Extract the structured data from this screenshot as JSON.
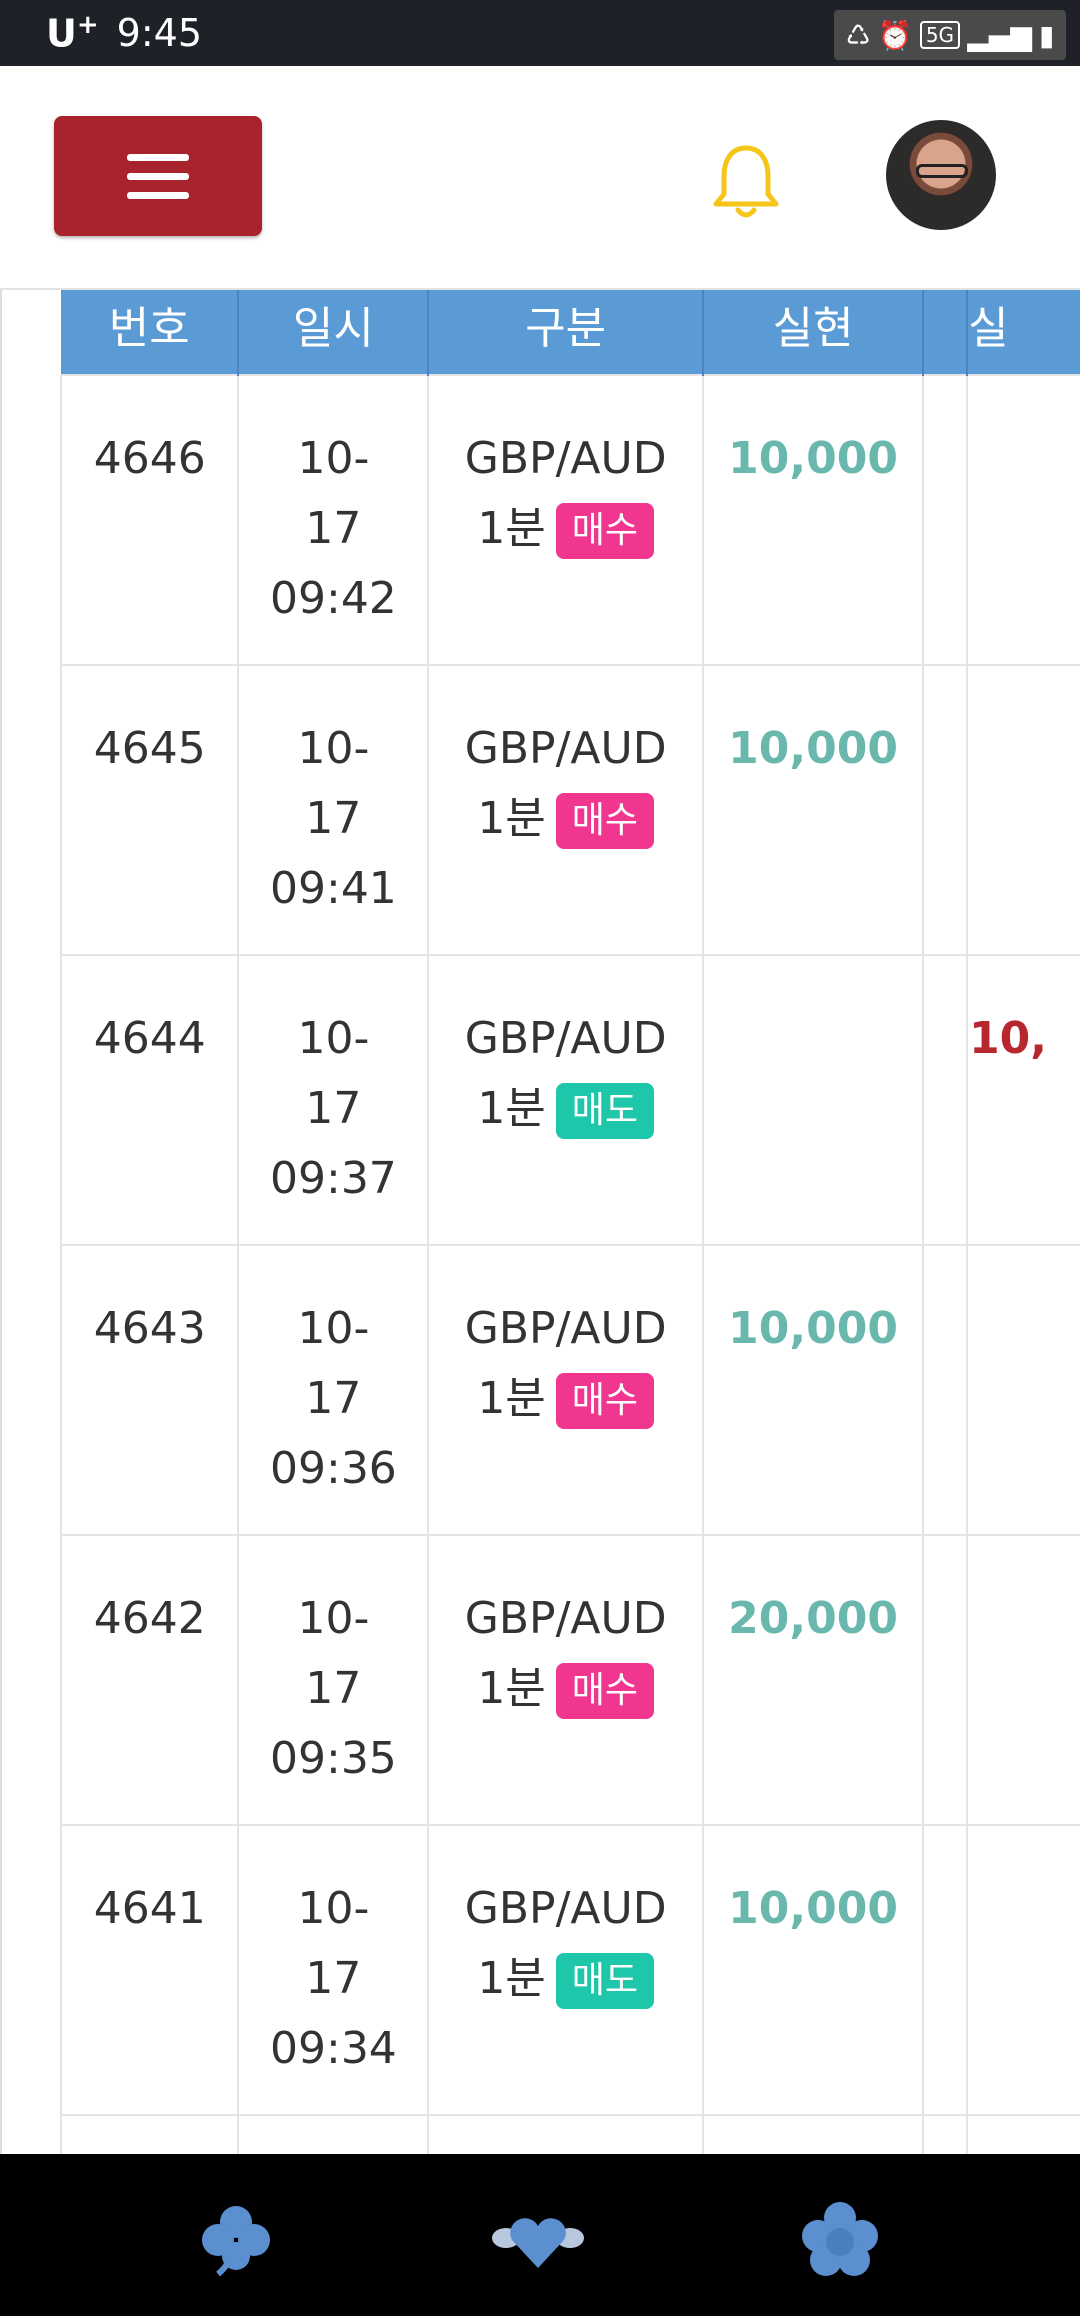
{
  "status_bar": {
    "carrier": "U",
    "carrier_sup": "+",
    "time": "9:45",
    "network": "5G"
  },
  "header": {
    "menu_label": "menu",
    "bell": "bell-icon",
    "avatar": "avatar"
  },
  "table": {
    "columns": [
      "번호",
      "일시",
      "구분",
      "실현",
      "실"
    ],
    "rows": [
      {
        "no": "4646",
        "date": "10-",
        "day": "17",
        "time": "09:42",
        "pair": "GBP/AUD",
        "period": "1분",
        "side": "매수",
        "side_type": "buy",
        "win": "10,000",
        "loss": ""
      },
      {
        "no": "4645",
        "date": "10-",
        "day": "17",
        "time": "09:41",
        "pair": "GBP/AUD",
        "period": "1분",
        "side": "매수",
        "side_type": "buy",
        "win": "10,000",
        "loss": ""
      },
      {
        "no": "4644",
        "date": "10-",
        "day": "17",
        "time": "09:37",
        "pair": "GBP/AUD",
        "period": "1분",
        "side": "매도",
        "side_type": "sell",
        "win": "",
        "loss": "10,"
      },
      {
        "no": "4643",
        "date": "10-",
        "day": "17",
        "time": "09:36",
        "pair": "GBP/AUD",
        "period": "1분",
        "side": "매수",
        "side_type": "buy",
        "win": "10,000",
        "loss": ""
      },
      {
        "no": "4642",
        "date": "10-",
        "day": "17",
        "time": "09:35",
        "pair": "GBP/AUD",
        "period": "1분",
        "side": "매수",
        "side_type": "buy",
        "win": "20,000",
        "loss": ""
      },
      {
        "no": "4641",
        "date": "10-",
        "day": "17",
        "time": "09:34",
        "pair": "GBP/AUD",
        "period": "1분",
        "side": "매도",
        "side_type": "sell",
        "win": "10,000",
        "loss": ""
      }
    ]
  },
  "colors": {
    "menu_button": "#a8232b",
    "header_blue": "#5b9bd5",
    "win_teal": "#6ab8ad",
    "loss_red": "#b8272d",
    "buy_pink": "#f0368e",
    "sell_teal": "#1ec6aa",
    "bell_yellow": "#f5c518"
  },
  "bottom_nav": {
    "items": [
      "clover-icon",
      "heart-wings-icon",
      "flower-icon"
    ]
  }
}
